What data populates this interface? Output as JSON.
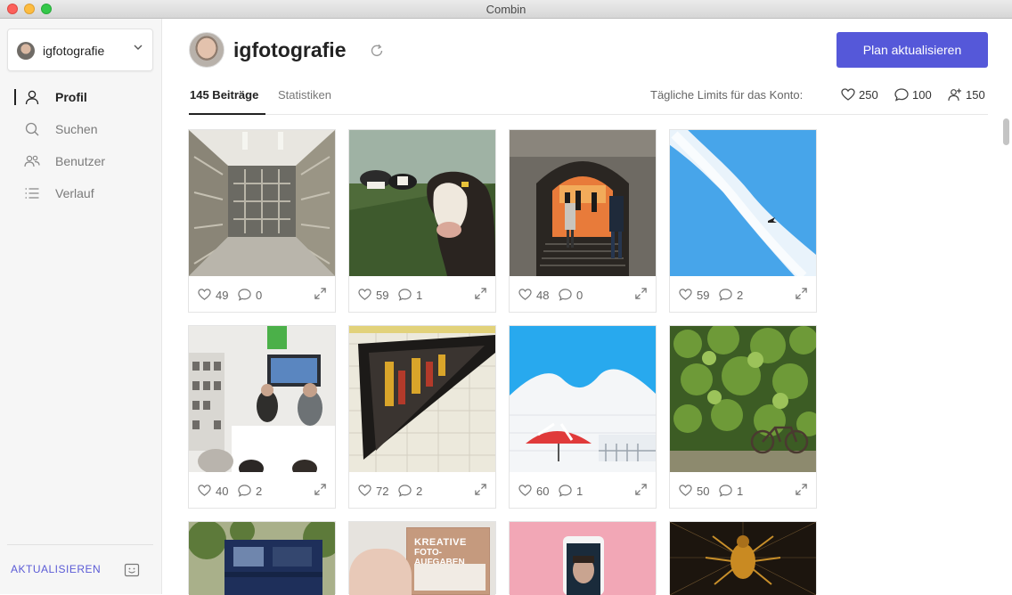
{
  "window": {
    "title": "Combin"
  },
  "sidebar": {
    "account": "igfotografie",
    "items": [
      {
        "label": "Profil",
        "icon": "user-icon",
        "active": true
      },
      {
        "label": "Suchen",
        "icon": "search-icon",
        "active": false
      },
      {
        "label": "Benutzer",
        "icon": "users-icon",
        "active": false
      },
      {
        "label": "Verlauf",
        "icon": "list-icon",
        "active": false
      }
    ],
    "update_label": "AKTUALISIEREN"
  },
  "header": {
    "username": "igfotografie",
    "plan_button": "Plan aktualisieren"
  },
  "tabs": [
    {
      "label": "145 Beiträge",
      "active": true
    },
    {
      "label": "Statistiken",
      "active": false
    }
  ],
  "limits": {
    "label": "Tägliche Limits für das Konto:",
    "likes": "250",
    "comments": "100",
    "follows": "150"
  },
  "colors": {
    "accent": "#5558d9",
    "link": "#5b5bd6"
  },
  "posts": [
    {
      "likes": "49",
      "comments": "0",
      "scene": "corridor"
    },
    {
      "likes": "59",
      "comments": "1",
      "scene": "cows"
    },
    {
      "likes": "48",
      "comments": "0",
      "scene": "tunnel"
    },
    {
      "likes": "59",
      "comments": "2",
      "scene": "sky-contrail"
    },
    {
      "likes": "40",
      "comments": "2",
      "scene": "book-fair-stage"
    },
    {
      "likes": "72",
      "comments": "2",
      "scene": "window-reflection"
    },
    {
      "likes": "60",
      "comments": "1",
      "scene": "umbrella-roof"
    },
    {
      "likes": "50",
      "comments": "1",
      "scene": "ivy-bicycle"
    },
    {
      "likes": "",
      "comments": "",
      "scene": "blue-truck"
    },
    {
      "likes": "",
      "comments": "",
      "scene": "book-cover"
    },
    {
      "likes": "",
      "comments": "",
      "scene": "phone-selfie"
    },
    {
      "likes": "",
      "comments": "",
      "scene": "spider"
    }
  ],
  "book_cover": {
    "line1": "KREATIVE",
    "line2": "FOTO-AUFGABEN"
  }
}
